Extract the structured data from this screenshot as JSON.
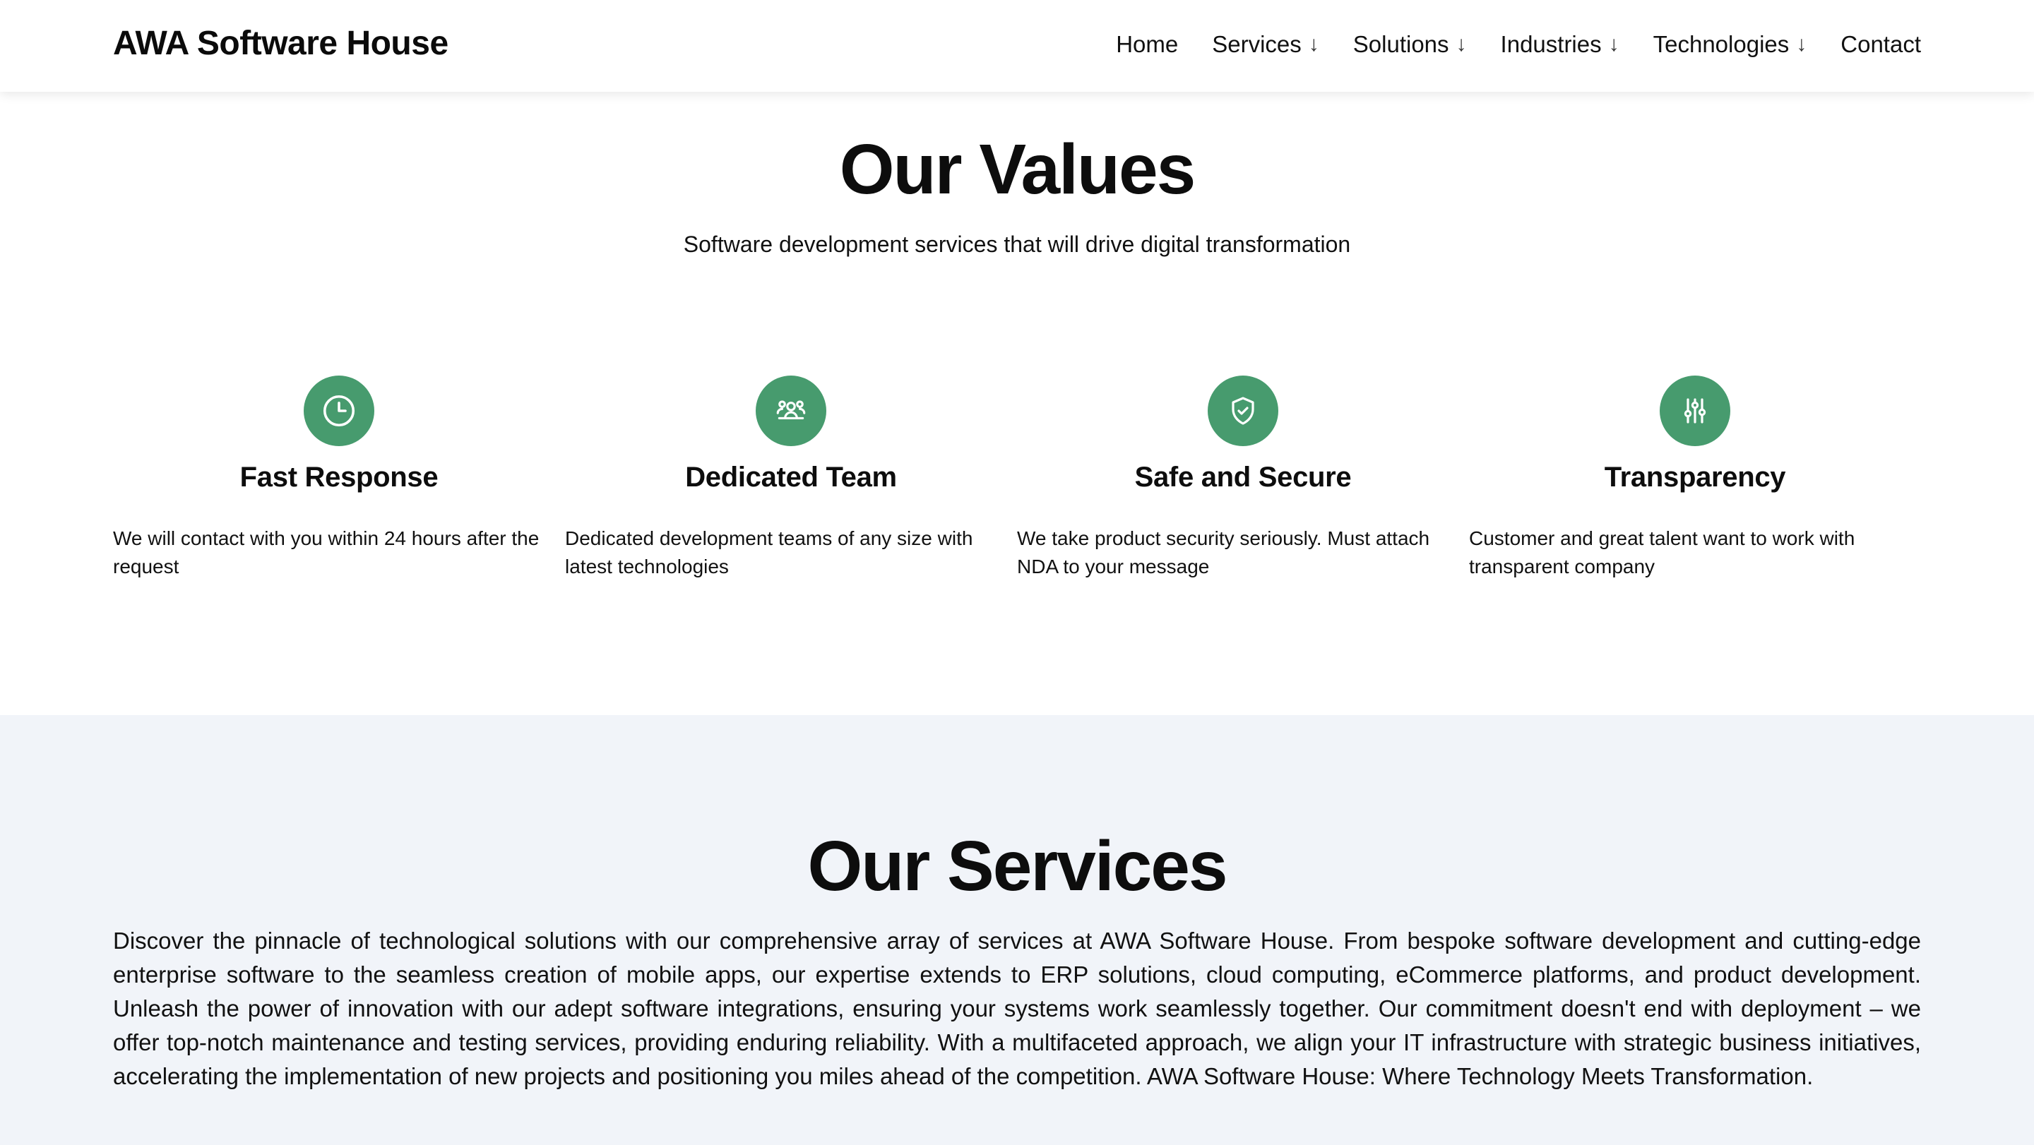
{
  "header": {
    "logo": "AWA Software House",
    "nav": [
      {
        "label": "Home",
        "dropdown": false
      },
      {
        "label": "Services",
        "dropdown": true
      },
      {
        "label": "Solutions",
        "dropdown": true
      },
      {
        "label": "Industries",
        "dropdown": true
      },
      {
        "label": "Technologies",
        "dropdown": true
      },
      {
        "label": "Contact",
        "dropdown": false
      }
    ],
    "dropdown_arrow": "↓"
  },
  "values": {
    "title": "Our Values",
    "subtitle": "Software development services that will drive digital transformation",
    "cards": [
      {
        "icon": "clock-icon",
        "title": "Fast Response",
        "description": "We will contact with you within 24 hours after the request"
      },
      {
        "icon": "team-icon",
        "title": "Dedicated Team",
        "description": "Dedicated development teams of any size with latest technologies"
      },
      {
        "icon": "shield-check-icon",
        "title": "Safe and Secure",
        "description": "We take product security seriously. Must attach NDA to your message"
      },
      {
        "icon": "sliders-icon",
        "title": "Transparency",
        "description": "Customer and great talent want to work with transparent company"
      }
    ]
  },
  "services": {
    "title": "Our Services",
    "text": "Discover the pinnacle of technological solutions with our comprehensive array of services at AWA Software House. From bespoke software development and cutting-edge enterprise software to the seamless creation of mobile apps, our expertise extends to ERP solutions, cloud computing, eCommerce platforms, and product development. Unleash the power of innovation with our adept software integrations, ensuring your systems work seamlessly together. Our commitment doesn't end with deployment – we offer top-notch maintenance and testing services, providing enduring reliability. With a multifaceted approach, we align your IT infrastructure with strategic business initiatives, accelerating the implementation of new projects and positioning you miles ahead of the competition. AWA Software House: Where Technology Meets Transformation."
  },
  "colors": {
    "accent": "#479b6e",
    "services_bg": "#f1f4f9",
    "text": "#0d0d0d"
  }
}
